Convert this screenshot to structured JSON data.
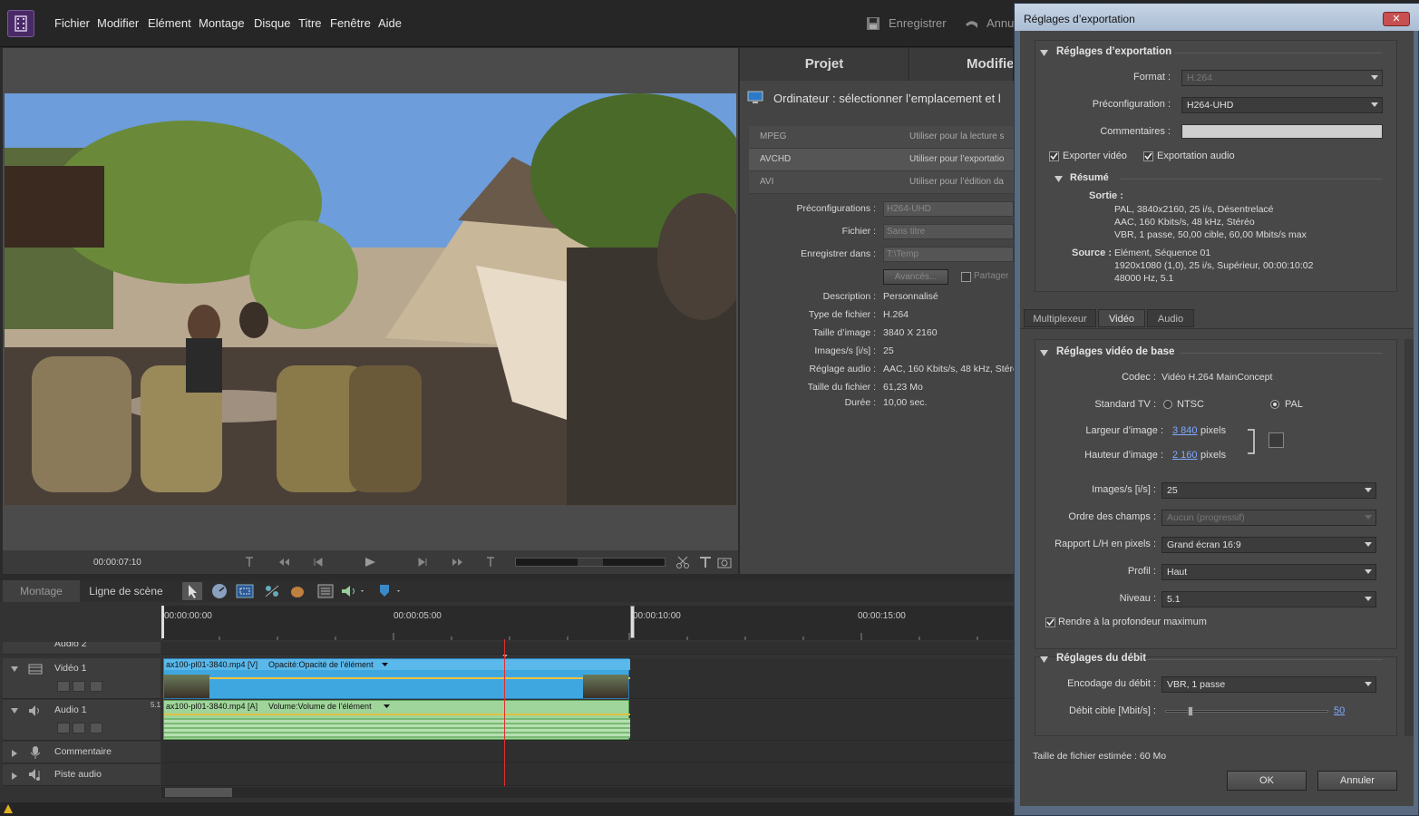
{
  "menubar": {
    "items": [
      "Fichier",
      "Modifier",
      "Elément",
      "Montage",
      "Disque",
      "Titre",
      "Fenêtre",
      "Aide"
    ],
    "save": "Enregistrer",
    "undo": "Annu"
  },
  "monitor": {
    "timecode": "00:00:07:10"
  },
  "project": {
    "tab_project": "Projet",
    "tab_modify": "Modifie",
    "location": "Ordinateur : sélectionner l’emplacement et l",
    "formats": [
      {
        "name": "MPEG",
        "desc": "Utiliser pour la lecture s"
      },
      {
        "name": "AVCHD",
        "desc": "Utiliser pour l’exportatio"
      },
      {
        "name": "AVI",
        "desc": "Utiliser pour l’édition da"
      }
    ],
    "presets_label": "Préconfigurations :",
    "presets_value": "H264-UHD",
    "file_label": "Fichier :",
    "file_value": "Sans titre",
    "saveto_label": "Enregistrer dans :",
    "saveto_value": "T:\\Temp",
    "advanced": "Avancés...",
    "share": "Partager",
    "props": [
      {
        "label": "Description :",
        "value": "Personnalisé"
      },
      {
        "label": "Type de fichier :",
        "value": "H.264"
      },
      {
        "label": "Taille d’image :",
        "value": "3840 X 2160"
      },
      {
        "label": "Images/s [i/s] :",
        "value": "25"
      },
      {
        "label": "Réglage audio :",
        "value": "AAC, 160 Kbits/s, 48 kHz, Stéré"
      },
      {
        "label": "Taille du fichier :",
        "value": "61,23 Mo"
      },
      {
        "label": "Durée :",
        "value": "10,00 sec."
      }
    ]
  },
  "timeline": {
    "tab_montage": "Montage",
    "tab_scene": "Ligne de scène",
    "ruler": [
      "00:00:00:00",
      "00:00:05:00",
      "00:00:10:00",
      "00:00:15:00"
    ],
    "tracks": {
      "audio2": "Audio 2",
      "video1": "Vidéo 1",
      "audio1": "Audio 1",
      "comment": "Commentaire",
      "music": "Piste audio"
    },
    "audio_channel": "5.1",
    "video_clip": "ax100-pl01-3840.mp4 [V]",
    "video_fx": "Opacité:Opacité de l’élément",
    "audio_clip": "ax100-pl01-3840.mp4 [A]",
    "audio_fx": "Volume:Volume de l’élément"
  },
  "dialog": {
    "title": "Réglages d’exportation",
    "section_export": "Réglages d’exportation",
    "format_label": "Format :",
    "format_value": "H.264",
    "preset_label": "Préconfiguration :",
    "preset_value": "H264-UHD",
    "comments_label": "Commentaires :",
    "export_video": "Exporter vidéo",
    "export_audio": "Exportation audio",
    "summary": "Résumé",
    "output_label": "Sortie :",
    "output_lines": [
      "PAL, 3840x2160, 25 i/s, Désentrelacé",
      "AAC, 160 Kbits/s, 48 kHz, Stéréo",
      "VBR, 1 passe, 50,00 cible, 60,00 Mbits/s max"
    ],
    "source_label": "Source :",
    "source_lines": [
      "Elément, Séquence 01",
      "1920x1080 (1,0), 25 i/s, Supérieur, 00:00:10:02",
      "48000 Hz, 5.1"
    ],
    "tabs": [
      "Multiplexeur",
      "Vidéo",
      "Audio"
    ],
    "section_video": "Réglages vidéo de base",
    "codec_label": "Codec :",
    "codec_value": "Vidéo H.264 MainConcept",
    "tv_label": "Standard TV :",
    "ntsc": "NTSC",
    "pal": "PAL",
    "width_label": "Largeur d’image :",
    "width_value": "3 840",
    "height_label": "Hauteur d’image :",
    "height_value": "2 160",
    "pixels": "pixels",
    "fps_label": "Images/s [i/s] :",
    "fps_value": "25",
    "field_label": "Ordre des champs :",
    "field_value": "Aucun (progressif)",
    "aspect_label": "Rapport L/H en pixels :",
    "aspect_value": "Grand écran 16:9",
    "profile_label": "Profil :",
    "profile_value": "Haut",
    "level_label": "Niveau :",
    "level_value": "5.1",
    "max_depth": "Rendre à la profondeur maximum",
    "section_bitrate": "Réglages du débit",
    "encoding_label": "Encodage du débit :",
    "encoding_value": "VBR, 1 passe",
    "target_label": "Débit cible [Mbit/s] :",
    "target_value": "50",
    "target_fraction": 0.15,
    "filesize": "Taille de fichier estimée : 60 Mo",
    "ok": "OK",
    "cancel": "Annuler"
  },
  "colors": {
    "accent_blue": "#3fa7e0",
    "audio_green": "#9fd59a",
    "link": "#7fa9ff",
    "playhead": "#e03030"
  }
}
